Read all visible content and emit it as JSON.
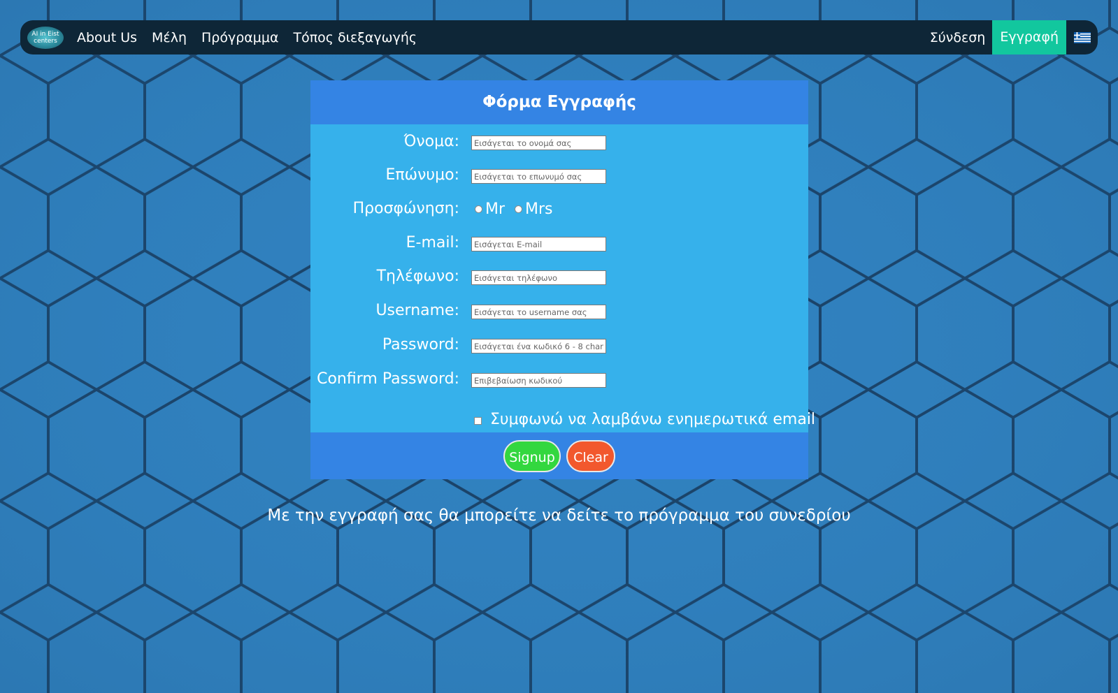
{
  "nav": {
    "logo_text": [
      "AI in Eist",
      "centers"
    ],
    "links": [
      "About Us",
      "Μέλη",
      "Πρόγραμμα",
      "Τόπος διεξαγωγής"
    ],
    "login": "Σύνδεση",
    "register": "Εγγραφή",
    "language_icon": "greek-flag-icon"
  },
  "form": {
    "title": "Φόρμα Εγγραφής",
    "fields": {
      "first_name": {
        "label": "Όνομα:",
        "placeholder": "Εισάγεται το ονομά σας"
      },
      "last_name": {
        "label": "Επώνυμο:",
        "placeholder": "Εισάγεται το επωνυμό σας"
      },
      "salutation": {
        "label": "Προσφώνηση:",
        "options": [
          "Mr",
          "Mrs"
        ]
      },
      "email": {
        "label": "E-mail:",
        "placeholder": "Εισάγεται E-mail"
      },
      "phone": {
        "label": "Τηλέφωνο:",
        "placeholder": "Εισάγεται τηλέφωνο"
      },
      "username": {
        "label": "Username:",
        "placeholder": "Εισάγεται το username σας"
      },
      "password": {
        "label": "Password:",
        "placeholder": "Εισάγεται ένα κωδικό 6 - 8 char."
      },
      "confirm_password": {
        "label": "Confirm Password:",
        "placeholder": "Επιβεβαίωση κωδικού"
      }
    },
    "newsletter_label": "Συμφωνώ να λαμβάνω ενημερωτικά email",
    "signup_label": "Signup",
    "clear_label": "Clear"
  },
  "notice": "Με την εγγραφή σας θα μπορείτε να δείτε το πρόγραμμα του συνεδρίου",
  "colors": {
    "background": "#2f79b6",
    "navbar": "#0e2637",
    "register_active": "#12c79e",
    "form_header": "#3484e4",
    "form_body": "#36b1eb",
    "signup_button": "#33d73f",
    "clear_button": "#f2582d"
  }
}
